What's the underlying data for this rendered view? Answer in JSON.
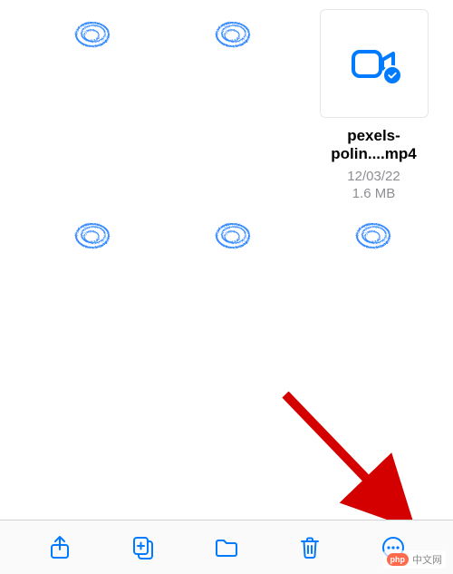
{
  "files": [
    {
      "kind": "document"
    },
    {
      "kind": "document"
    },
    {
      "kind": "video",
      "name": "pexels-polin....mp4",
      "date": "12/03/22",
      "size": "1.6 MB",
      "selected": true
    },
    {
      "kind": "document"
    },
    {
      "kind": "document"
    },
    {
      "kind": "document"
    }
  ],
  "toolbar": {
    "share_label": "Share",
    "duplicate_label": "Duplicate",
    "move_label": "Move",
    "delete_label": "Delete",
    "more_label": "More"
  },
  "colors": {
    "accent": "#007aff",
    "arrow": "#d40000",
    "text_secondary": "#8e8e93"
  },
  "watermark": {
    "badge": "php",
    "text": "中文网"
  }
}
